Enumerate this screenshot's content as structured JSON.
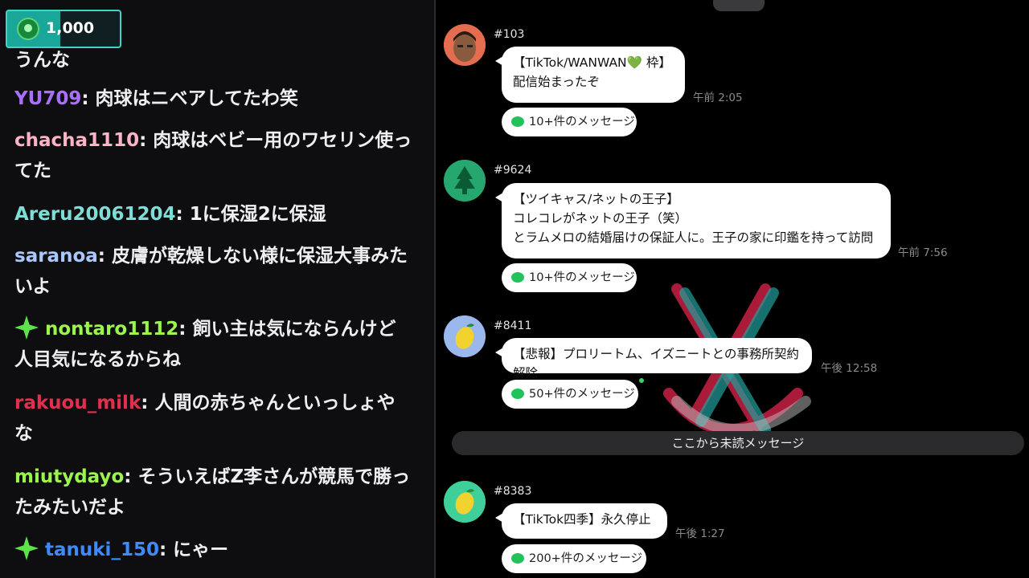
{
  "chat": {
    "points": "1,000",
    "cutoff_text": "うんな",
    "messages": [
      {
        "user": "YU709",
        "color": "#a970ff",
        "text": ": 肉球はニベアしてたわ笑",
        "badge": false
      },
      {
        "user": "chacha1110",
        "color": "#ffb3c6",
        "text": ": 肉球はベビー用のワセリン使ってた",
        "badge": false
      },
      {
        "user": "Areru20061204",
        "color": "#7dded7",
        "text": ": 1に保湿2に保湿",
        "badge": false
      },
      {
        "user": "saranoa",
        "color": "#a8c8ff",
        "text": ": 皮膚が乾燥しない様に保湿大事みたいよ",
        "badge": false
      },
      {
        "user": "nontaro1112",
        "color": "#9cf54c",
        "text": ": 飼い主は気にならんけど人目気になるからね",
        "badge": true
      },
      {
        "user": "rakuou_milk",
        "color": "#e0304e",
        "text": ": 人間の赤ちゃんといっしょやな",
        "badge": false
      },
      {
        "user": "miutydayo",
        "color": "#9cf54c",
        "text": ": そういえばZ李さんが競馬で勝ったみたいだよ",
        "badge": false
      },
      {
        "user": "tanuki_150",
        "color": "#3d8bff",
        "text": ": にゃー",
        "badge": true
      }
    ]
  },
  "line_panel": {
    "unread_label": "ここから未読メッセージ",
    "messages": [
      {
        "num": "#103",
        "lines": [
          "【TikTok/WANWAN",
          "💚",
          " 枠】",
          "配信始まったぞ"
        ],
        "time": "午前 2:05",
        "replies": "10+件のメッセージ"
      },
      {
        "num": "#9624",
        "lines": [
          "【ツイキャス/ネットの王子】",
          "コレコレがネットの王子（笑）",
          "とラムメロの結婚届けの保証人に。王子の家に印鑑を持って訪問"
        ],
        "time": "午前 7:56",
        "replies": "10+件のメッセージ"
      },
      {
        "num": "#8411",
        "lines": [
          "【悲報】プロリートム、イズニートとの事務所契約解除"
        ],
        "time": "午後 12:58",
        "replies": "50+件のメッセージ"
      },
      {
        "num": "#8383",
        "lines": [
          "【TikTok四季】永久停止"
        ],
        "time": "午後 1:27",
        "replies": "200+件のメッセージ"
      }
    ]
  },
  "colors": {
    "accent": "#3dd6c4",
    "line_green": "#21c15b"
  }
}
